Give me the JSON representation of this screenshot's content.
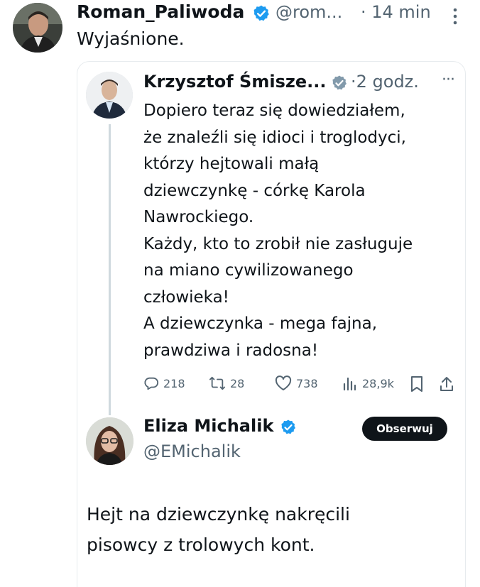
{
  "colors": {
    "text": "#0f1419",
    "muted": "#536471",
    "verified": "#1d9bf0",
    "verified_gray": "#829aab",
    "card_border": "#e7ebee",
    "thread_line": "#cfd9de"
  },
  "main_tweet": {
    "name": "Roman_Paliwoda",
    "handle": "@rom...",
    "time": "· 14 min",
    "text": "Wyjaśnione."
  },
  "quoted_tweet": {
    "name": "Krzysztof Śmisze...",
    "time": "·2 godz.",
    "lines": [
      "Dopiero teraz się dowiedziałem,",
      "że znaleźli się idioci i troglodyci,",
      "którzy hejtowali małą",
      "dziewczynkę - córkę Karola",
      "Nawrockiego.",
      "Każdy, kto to zrobił nie zasługuje",
      "na miano cywilizowanego",
      "człowieka!",
      "A dziewczynka - mega fajna,",
      "prawdziwa i radosna!"
    ],
    "stats": {
      "replies": "218",
      "retweets": "28",
      "likes": "738",
      "views": "28,9k"
    }
  },
  "reply_tweet": {
    "name": "Eliza Michalik",
    "handle": "@EMichalik",
    "follow_label": "Obserwuj",
    "lines": [
      "Hejt na dziewczynkę nakręcili",
      "pisowcy z trolowych kont."
    ]
  }
}
